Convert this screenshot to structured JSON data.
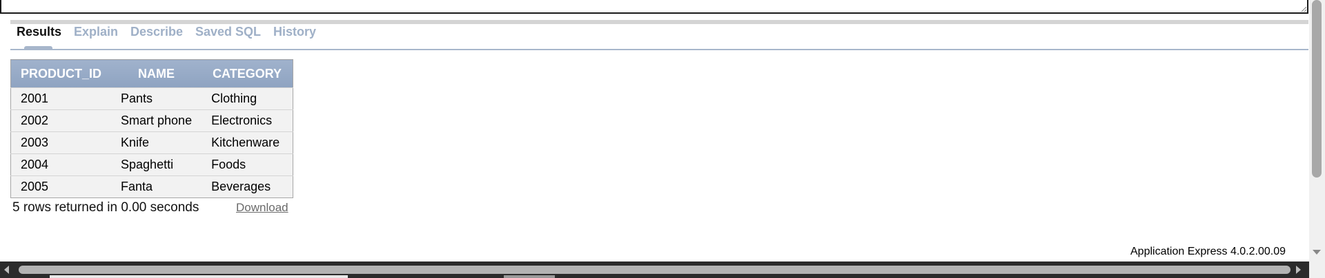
{
  "tabs": [
    {
      "label": "Results",
      "active": true
    },
    {
      "label": "Explain",
      "active": false
    },
    {
      "label": "Describe",
      "active": false
    },
    {
      "label": "Saved SQL",
      "active": false
    },
    {
      "label": "History",
      "active": false
    }
  ],
  "results_table": {
    "columns": [
      "PRODUCT_ID",
      "NAME",
      "CATEGORY"
    ],
    "rows": [
      [
        "2001",
        "Pants",
        "Clothing"
      ],
      [
        "2002",
        "Smart phone",
        "Electronics"
      ],
      [
        "2003",
        "Knife",
        "Kitchenware"
      ],
      [
        "2004",
        "Spaghetti",
        "Foods"
      ],
      [
        "2005",
        "Fanta",
        "Beverages"
      ]
    ]
  },
  "footer": {
    "rows_returned": "5 rows returned in 0.00 seconds",
    "download_label": "Download",
    "version": "Application Express 4.0.2.00.09"
  },
  "colors": {
    "header_bg": "#95a8c4",
    "inactive_tab": "#9fb0c7",
    "active_tab": "#111111"
  }
}
